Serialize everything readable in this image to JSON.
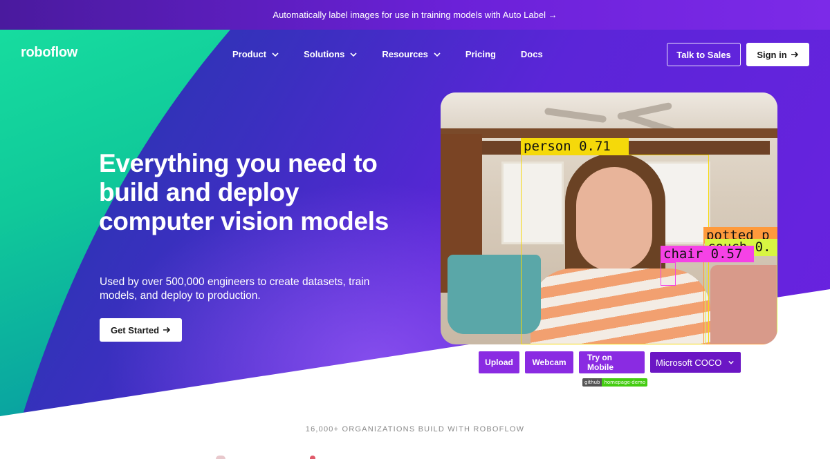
{
  "announcement": {
    "text": "Automatically label images for use in training models with Auto Label →"
  },
  "nav": {
    "logo": "roboflow",
    "items": [
      {
        "label": "Product",
        "dropdown": true
      },
      {
        "label": "Solutions",
        "dropdown": true
      },
      {
        "label": "Resources",
        "dropdown": true
      },
      {
        "label": "Pricing",
        "dropdown": false
      },
      {
        "label": "Docs",
        "dropdown": false
      }
    ],
    "talk_to_sales": "Talk to Sales",
    "sign_in": "Sign in"
  },
  "hero": {
    "headline": "Everything you need to build and deploy computer vision models",
    "subtext": "Used by over 500,000 engineers to create datasets, train models, and deploy to production.",
    "cta": "Get Started"
  },
  "demo": {
    "detections": [
      {
        "label": "person 0.71",
        "color": "#f5d90a"
      },
      {
        "label": "potted p",
        "color": "#ff9a3c"
      },
      {
        "label": "couch 0.",
        "color": "#d8f542"
      },
      {
        "label": "chair 0.57",
        "color": "#f542e6"
      }
    ],
    "buttons": {
      "upload": "Upload",
      "webcam": "Webcam",
      "mobile": "Try on Mobile"
    },
    "model": "Microsoft COCO",
    "badge": {
      "left": "github",
      "right": "homepage-demo"
    }
  },
  "orgs_heading": "16,000+ ORGANIZATIONS BUILD WITH ROBOFLOW",
  "colors": {
    "accent_purple": "#8a2be2",
    "hero_green": "#10c99a",
    "hero_purple": "#5b25d8"
  }
}
